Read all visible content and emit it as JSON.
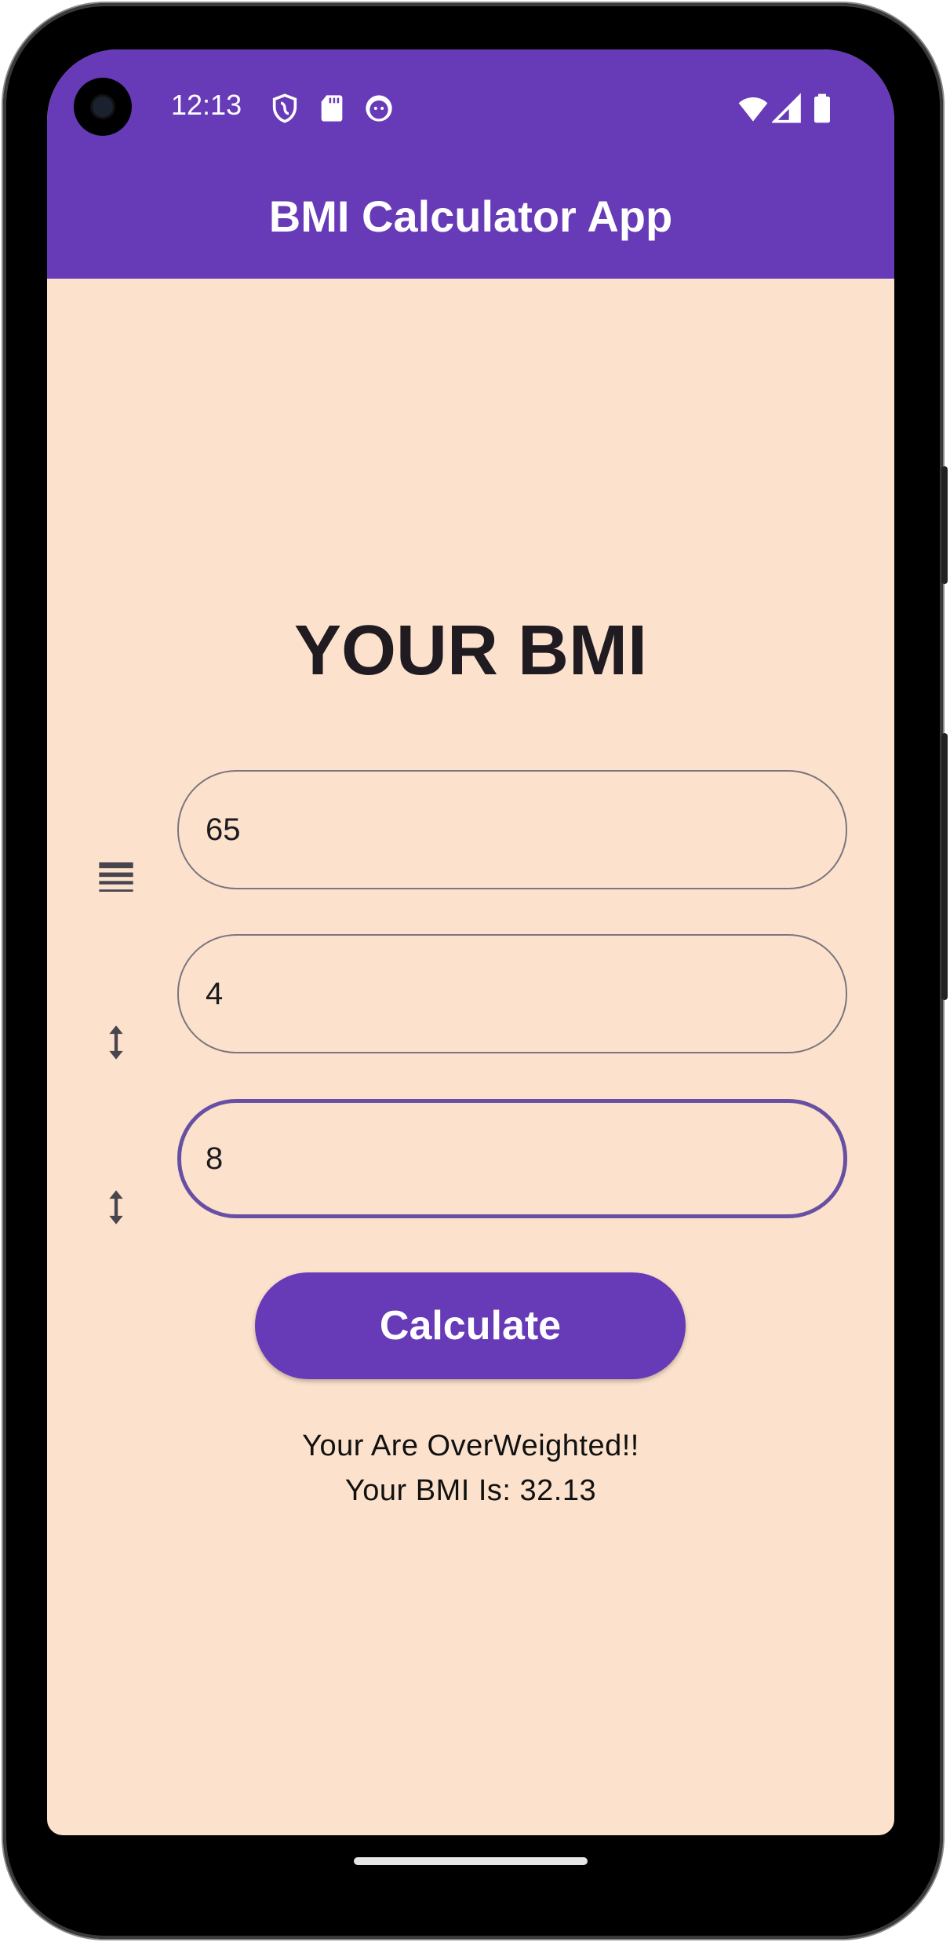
{
  "status_bar": {
    "time": "12:13",
    "icons": [
      "shield-icon",
      "sd-card-icon",
      "cat-face-icon",
      "wifi-icon",
      "signal-icon",
      "battery-icon"
    ]
  },
  "app_bar": {
    "title": "BMI Calculator App"
  },
  "main": {
    "heading": "YOUR BMI",
    "fields": [
      {
        "icon": "weight-lines-icon",
        "value": "65"
      },
      {
        "icon": "height-arrow-icon",
        "value": "4"
      },
      {
        "icon": "height-arrow-icon",
        "value": "8",
        "focused": true
      }
    ],
    "calculate_label": "Calculate",
    "result_line1": "Your Are OverWeighted!!",
    "result_line2": "Your BMI Is: 32.13"
  },
  "colors": {
    "primary": "#673ab7",
    "background": "#fce2cc",
    "focus_border": "#6750a4"
  }
}
